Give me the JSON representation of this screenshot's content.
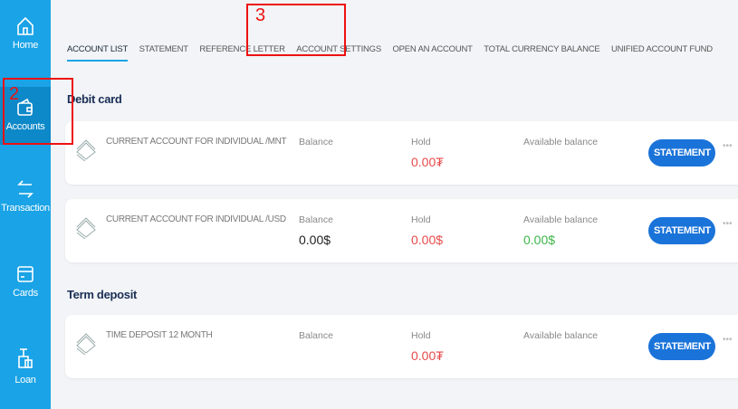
{
  "sidebar": {
    "items": [
      {
        "label": "Home",
        "icon": "home-icon"
      },
      {
        "label": "Accounts",
        "icon": "wallet-icon"
      },
      {
        "label": "Transaction",
        "icon": "transfer-icon"
      },
      {
        "label": "Cards",
        "icon": "card-icon"
      },
      {
        "label": "Loan",
        "icon": "loan-icon"
      }
    ]
  },
  "tabs": [
    "ACCOUNT LIST",
    "STATEMENT",
    "REFERENCE LETTER",
    "ACCOUNT SETTINGS",
    "OPEN AN ACCOUNT",
    "TOTAL CURRENCY BALANCE",
    "UNIFIED ACCOUNT FUND"
  ],
  "sections": {
    "debit": "Debit card",
    "term": "Term deposit"
  },
  "accounts": [
    {
      "name": "CURRENT ACCOUNT FOR INDIVIDUAL /MNT",
      "balance_label": "Balance",
      "balance": "",
      "hold_label": "Hold",
      "hold": "0.00₮",
      "available_label": "Available balance",
      "available": "",
      "button": "STATEMENT",
      "more": "•••"
    },
    {
      "name": "CURRENT ACCOUNT FOR INDIVIDUAL /USD",
      "balance_label": "Balance",
      "balance": "0.00$",
      "hold_label": "Hold",
      "hold": "0.00$",
      "available_label": "Available balance",
      "available": "0.00$",
      "button": "STATEMENT",
      "more": "•••"
    },
    {
      "name": "TIME DEPOSIT 12 MONTH",
      "balance_label": "Balance",
      "balance": "",
      "hold_label": "Hold",
      "hold": "0.00₮",
      "available_label": "Available balance",
      "available": "",
      "button": "STATEMENT",
      "more": "•••"
    }
  ],
  "annotations": {
    "two": "2",
    "three": "3"
  },
  "colors": {
    "sidebar": "#1aa3e6",
    "button": "#1a73d9",
    "hold": "#e64a4a",
    "available": "#3cb64a",
    "annotation": "#ee1111"
  }
}
